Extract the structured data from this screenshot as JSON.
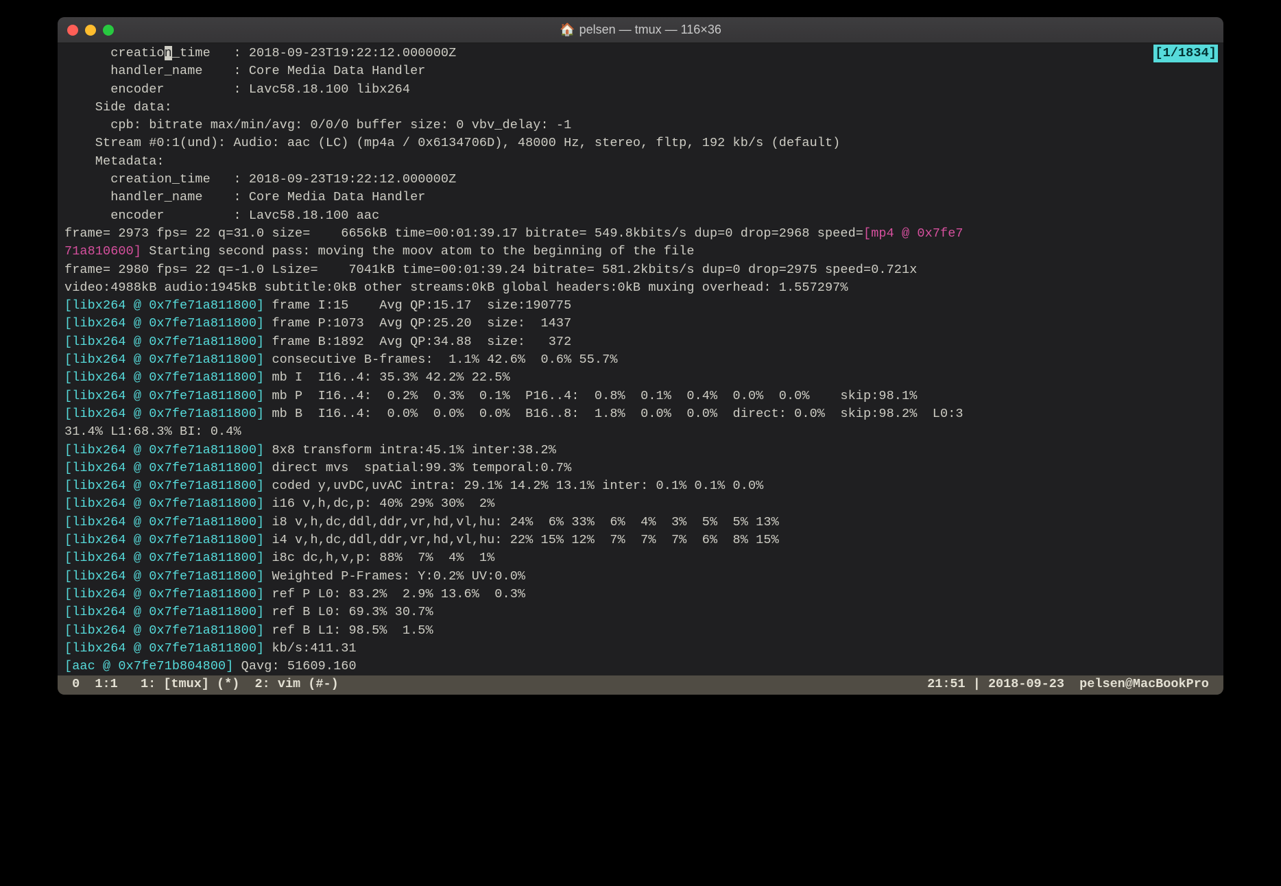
{
  "window": {
    "title": "pelsen — tmux — 116×36"
  },
  "search_indicator": "[1/1834]",
  "lines": [
    {
      "segments": [
        {
          "cls": "",
          "text": "      creatio"
        },
        {
          "cls": "cursor-mark",
          "text": "n"
        },
        {
          "cls": "",
          "text": "_time   : 2018-09-23T19:22:12.000000Z"
        }
      ]
    },
    {
      "segments": [
        {
          "cls": "",
          "text": "      handler_name    : Core Media Data Handler"
        }
      ]
    },
    {
      "segments": [
        {
          "cls": "",
          "text": "      encoder         : Lavc58.18.100 libx264"
        }
      ]
    },
    {
      "segments": [
        {
          "cls": "",
          "text": "    Side data:"
        }
      ]
    },
    {
      "segments": [
        {
          "cls": "",
          "text": "      cpb: bitrate max/min/avg: 0/0/0 buffer size: 0 vbv_delay: -1"
        }
      ]
    },
    {
      "segments": [
        {
          "cls": "",
          "text": "    Stream #0:1(und): Audio: aac (LC) (mp4a / 0x6134706D), 48000 Hz, stereo, fltp, 192 kb/s (default)"
        }
      ]
    },
    {
      "segments": [
        {
          "cls": "",
          "text": "    Metadata:"
        }
      ]
    },
    {
      "segments": [
        {
          "cls": "",
          "text": "      creation_time   : 2018-09-23T19:22:12.000000Z"
        }
      ]
    },
    {
      "segments": [
        {
          "cls": "",
          "text": "      handler_name    : Core Media Data Handler"
        }
      ]
    },
    {
      "segments": [
        {
          "cls": "",
          "text": "      encoder         : Lavc58.18.100 aac"
        }
      ]
    },
    {
      "segments": [
        {
          "cls": "",
          "text": "frame= 2973 fps= 22 q=31.0 size=    6656kB time=00:01:39.17 bitrate= 549.8kbits/s dup=0 drop=2968 speed="
        },
        {
          "cls": "magenta",
          "text": "[mp4 @ 0x7fe7"
        }
      ]
    },
    {
      "segments": [
        {
          "cls": "magenta",
          "text": "71a810600]"
        },
        {
          "cls": "",
          "text": " Starting second pass: moving the moov atom to the beginning of the file"
        }
      ]
    },
    {
      "segments": [
        {
          "cls": "",
          "text": "frame= 2980 fps= 22 q=-1.0 Lsize=    7041kB time=00:01:39.24 bitrate= 581.2kbits/s dup=0 drop=2975 speed=0.721x"
        }
      ]
    },
    {
      "segments": [
        {
          "cls": "",
          "text": "video:4988kB audio:1945kB subtitle:0kB other streams:0kB global headers:0kB muxing overhead: 1.557297%"
        }
      ]
    },
    {
      "segments": [
        {
          "cls": "cyan",
          "text": "[libx264 @ 0x7fe71a811800]"
        },
        {
          "cls": "",
          "text": " frame I:15    Avg QP:15.17  size:190775"
        }
      ]
    },
    {
      "segments": [
        {
          "cls": "cyan",
          "text": "[libx264 @ 0x7fe71a811800]"
        },
        {
          "cls": "",
          "text": " frame P:1073  Avg QP:25.20  size:  1437"
        }
      ]
    },
    {
      "segments": [
        {
          "cls": "cyan",
          "text": "[libx264 @ 0x7fe71a811800]"
        },
        {
          "cls": "",
          "text": " frame B:1892  Avg QP:34.88  size:   372"
        }
      ]
    },
    {
      "segments": [
        {
          "cls": "cyan",
          "text": "[libx264 @ 0x7fe71a811800]"
        },
        {
          "cls": "",
          "text": " consecutive B-frames:  1.1% 42.6%  0.6% 55.7%"
        }
      ]
    },
    {
      "segments": [
        {
          "cls": "cyan",
          "text": "[libx264 @ 0x7fe71a811800]"
        },
        {
          "cls": "",
          "text": " mb I  I16..4: 35.3% 42.2% 22.5%"
        }
      ]
    },
    {
      "segments": [
        {
          "cls": "cyan",
          "text": "[libx264 @ 0x7fe71a811800]"
        },
        {
          "cls": "",
          "text": " mb P  I16..4:  0.2%  0.3%  0.1%  P16..4:  0.8%  0.1%  0.4%  0.0%  0.0%    skip:98.1%"
        }
      ]
    },
    {
      "segments": [
        {
          "cls": "cyan",
          "text": "[libx264 @ 0x7fe71a811800]"
        },
        {
          "cls": "",
          "text": " mb B  I16..4:  0.0%  0.0%  0.0%  B16..8:  1.8%  0.0%  0.0%  direct: 0.0%  skip:98.2%  L0:3"
        }
      ]
    },
    {
      "segments": [
        {
          "cls": "",
          "text": "31.4% L1:68.3% BI: 0.4%"
        }
      ]
    },
    {
      "segments": [
        {
          "cls": "cyan",
          "text": "[libx264 @ 0x7fe71a811800]"
        },
        {
          "cls": "",
          "text": " 8x8 transform intra:45.1% inter:38.2%"
        }
      ]
    },
    {
      "segments": [
        {
          "cls": "cyan",
          "text": "[libx264 @ 0x7fe71a811800]"
        },
        {
          "cls": "",
          "text": " direct mvs  spatial:99.3% temporal:0.7%"
        }
      ]
    },
    {
      "segments": [
        {
          "cls": "cyan",
          "text": "[libx264 @ 0x7fe71a811800]"
        },
        {
          "cls": "",
          "text": " coded y,uvDC,uvAC intra: 29.1% 14.2% 13.1% inter: 0.1% 0.1% 0.0%"
        }
      ]
    },
    {
      "segments": [
        {
          "cls": "cyan",
          "text": "[libx264 @ 0x7fe71a811800]"
        },
        {
          "cls": "",
          "text": " i16 v,h,dc,p: 40% 29% 30%  2%"
        }
      ]
    },
    {
      "segments": [
        {
          "cls": "cyan",
          "text": "[libx264 @ 0x7fe71a811800]"
        },
        {
          "cls": "",
          "text": " i8 v,h,dc,ddl,ddr,vr,hd,vl,hu: 24%  6% 33%  6%  4%  3%  5%  5% 13%"
        }
      ]
    },
    {
      "segments": [
        {
          "cls": "cyan",
          "text": "[libx264 @ 0x7fe71a811800]"
        },
        {
          "cls": "",
          "text": " i4 v,h,dc,ddl,ddr,vr,hd,vl,hu: 22% 15% 12%  7%  7%  7%  6%  8% 15%"
        }
      ]
    },
    {
      "segments": [
        {
          "cls": "cyan",
          "text": "[libx264 @ 0x7fe71a811800]"
        },
        {
          "cls": "",
          "text": " i8c dc,h,v,p: 88%  7%  4%  1%"
        }
      ]
    },
    {
      "segments": [
        {
          "cls": "cyan",
          "text": "[libx264 @ 0x7fe71a811800]"
        },
        {
          "cls": "",
          "text": " Weighted P-Frames: Y:0.2% UV:0.0%"
        }
      ]
    },
    {
      "segments": [
        {
          "cls": "cyan",
          "text": "[libx264 @ 0x7fe71a811800]"
        },
        {
          "cls": "",
          "text": " ref P L0: 83.2%  2.9% 13.6%  0.3%"
        }
      ]
    },
    {
      "segments": [
        {
          "cls": "cyan",
          "text": "[libx264 @ 0x7fe71a811800]"
        },
        {
          "cls": "",
          "text": " ref B L0: 69.3% 30.7%"
        }
      ]
    },
    {
      "segments": [
        {
          "cls": "cyan",
          "text": "[libx264 @ 0x7fe71a811800]"
        },
        {
          "cls": "",
          "text": " ref B L1: 98.5%  1.5%"
        }
      ]
    },
    {
      "segments": [
        {
          "cls": "cyan",
          "text": "[libx264 @ 0x7fe71a811800]"
        },
        {
          "cls": "",
          "text": " kb/s:411.31"
        }
      ]
    },
    {
      "segments": [
        {
          "cls": "cyan",
          "text": "[aac @ 0x7fe71b804800]"
        },
        {
          "cls": "",
          "text": " Qavg: 51609.160"
        }
      ]
    }
  ],
  "statusbar": {
    "left": " 0  1:1   1: [tmux] (*)  2: vim (#-)",
    "right": "21:51 | 2018-09-23  pelsen@MacBookPro "
  }
}
